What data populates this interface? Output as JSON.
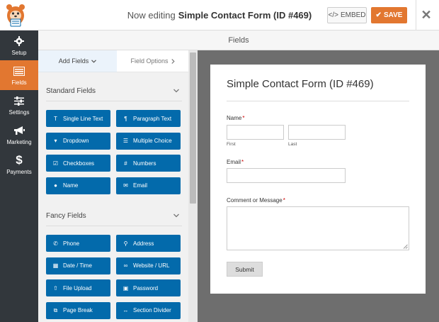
{
  "header": {
    "editing_prefix": "Now editing",
    "form_name": "Simple Contact Form (ID #469)",
    "embed_label": "EMBED",
    "save_label": "SAVE",
    "accent": "#e27730"
  },
  "sidebar": {
    "items": [
      {
        "label": "Setup",
        "icon": "gear-icon"
      },
      {
        "label": "Fields",
        "icon": "list-icon"
      },
      {
        "label": "Settings",
        "icon": "sliders-icon"
      },
      {
        "label": "Marketing",
        "icon": "megaphone-icon"
      },
      {
        "label": "Payments",
        "icon": "dollar-icon"
      }
    ],
    "active": "Fields"
  },
  "fields_header": "Fields",
  "panel": {
    "tabs": {
      "add": "Add Fields",
      "options": "Field Options"
    },
    "standard": {
      "title": "Standard Fields",
      "buttons": [
        {
          "label": "Single Line Text",
          "icon": "text-line-icon"
        },
        {
          "label": "Paragraph Text",
          "icon": "paragraph-icon"
        },
        {
          "label": "Dropdown",
          "icon": "dropdown-icon"
        },
        {
          "label": "Multiple Choice",
          "icon": "list-bullet-icon"
        },
        {
          "label": "Checkboxes",
          "icon": "checkbox-icon"
        },
        {
          "label": "Numbers",
          "icon": "hash-icon"
        },
        {
          "label": "Name",
          "icon": "user-icon"
        },
        {
          "label": "Email",
          "icon": "envelope-icon"
        }
      ]
    },
    "fancy": {
      "title": "Fancy Fields",
      "buttons": [
        {
          "label": "Phone",
          "icon": "phone-icon"
        },
        {
          "label": "Address",
          "icon": "map-pin-icon"
        },
        {
          "label": "Date / Time",
          "icon": "calendar-icon"
        },
        {
          "label": "Website / URL",
          "icon": "link-icon"
        },
        {
          "label": "File Upload",
          "icon": "upload-icon"
        },
        {
          "label": "Password",
          "icon": "lock-icon"
        },
        {
          "label": "Page Break",
          "icon": "copy-icon"
        },
        {
          "label": "Section Divider",
          "icon": "divider-icon"
        }
      ]
    },
    "button_color": "#036aab"
  },
  "form": {
    "title": "Simple Contact Form (ID #469)",
    "name_label": "Name",
    "first_label": "First",
    "last_label": "Last",
    "email_label": "Email",
    "comment_label": "Comment or Message",
    "required_marker": "*",
    "submit_label": "Submit"
  }
}
